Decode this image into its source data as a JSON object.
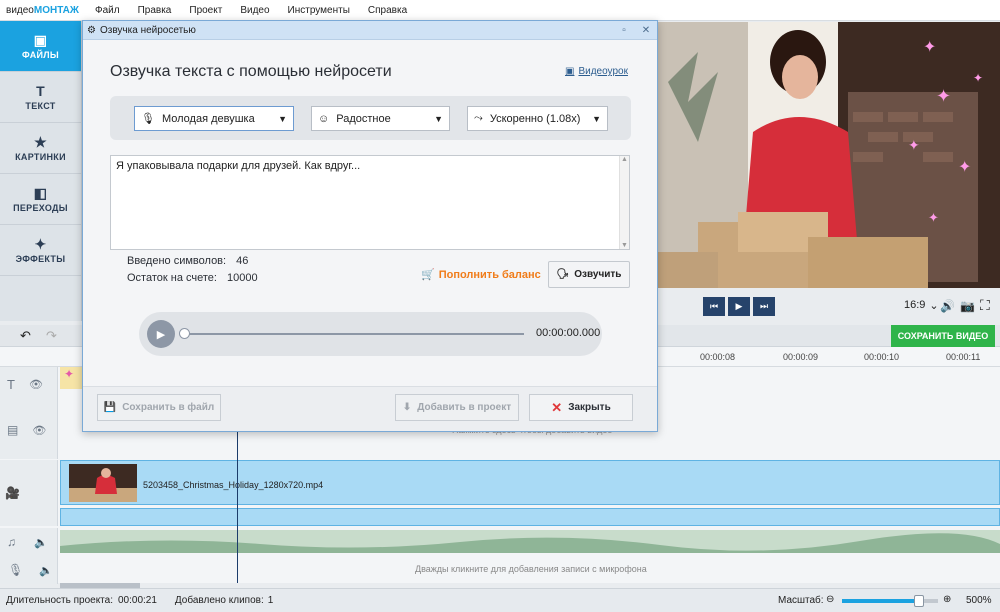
{
  "app": {
    "logo_part1": "видео",
    "logo_part2": "МОНТАЖ"
  },
  "menu": [
    "Файл",
    "Правка",
    "Проект",
    "Видео",
    "Инструменты",
    "Справка"
  ],
  "sidebar": [
    {
      "label": "ФАЙЛЫ",
      "icon": "folder-icon"
    },
    {
      "label": "ТЕКСТ",
      "icon": "text-icon"
    },
    {
      "label": "КАРТИНКИ",
      "icon": "star-icon"
    },
    {
      "label": "ПЕРЕХОДЫ",
      "icon": "transitions-icon"
    },
    {
      "label": "ЭФФЕКТЫ",
      "icon": "magic-wand-icon"
    }
  ],
  "player_controls": {
    "aspect": "16:9",
    "aspect_arrow": "⌄"
  },
  "save_video": "СОХРАНИТЬ ВИДЕО",
  "ruler": [
    "00:00:08",
    "00:00:09",
    "00:00:10",
    "00:00:11"
  ],
  "tracks": {
    "clip_name": "5203458_Christmas_Holiday_1280x720.mp4",
    "hint_behind": "Нажмите здесь чтобы добавить видео",
    "mic_hint": "Дважды кликните для добавления записи с микрофона"
  },
  "status": {
    "duration_label": "Длительность проекта:",
    "duration_value": "00:00:21",
    "clips_label": "Добавлено клипов:",
    "clips_value": "1",
    "scale_label": "Масштаб:",
    "zoom": "500%",
    "zoom_fraction": 0.8
  },
  "dialog": {
    "title": "Озвучка нейросетью",
    "heading": "Озвучка текста с помощью нейросети",
    "video_lesson": "Видеоурок",
    "voice": "Молодая девушка",
    "mood": "Радостное",
    "speed": "Ускоренно (1.08x)",
    "text": "Я упаковывала подарки для друзей. Как вдруг...",
    "chars_label": "Введено символов:",
    "chars_value": "46",
    "balance_label": "Остаток на счете:",
    "balance_value": "10000",
    "topup": "Пополнить баланс",
    "voice_button": "Озвучить",
    "time": "00:00:00.000",
    "save_file": "Сохранить в файл",
    "add_project": "Добавить в проект",
    "close": "Закрыть"
  },
  "colors": {
    "accent": "#1ba2e0",
    "save_green": "#2fb44a",
    "orange": "#f07c1a"
  }
}
